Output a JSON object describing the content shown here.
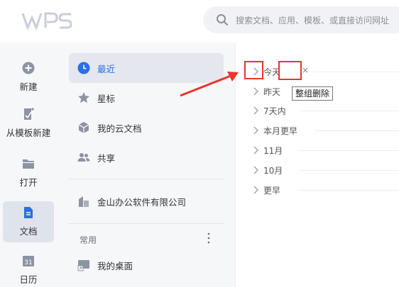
{
  "app": {
    "logo_text": "WPS",
    "accent": "#2b6ee8",
    "annotation_color": "#e8352f"
  },
  "search": {
    "placeholder": "搜索文档、应用、模板、或直接访问网址",
    "icon": "search-icon"
  },
  "rail": {
    "items": [
      {
        "label": "新建",
        "icon": "plus-circle-icon"
      },
      {
        "label": "从模板新建",
        "icon": "template-icon"
      },
      {
        "label": "打开",
        "icon": "folder-icon"
      },
      {
        "label": "文档",
        "icon": "document-icon",
        "active": true
      },
      {
        "label": "日历",
        "icon": "calendar-icon",
        "badge": "31"
      }
    ]
  },
  "nav": {
    "items": [
      {
        "label": "最近",
        "icon": "clock-icon",
        "active": true
      },
      {
        "label": "星标",
        "icon": "star-icon"
      },
      {
        "label": "我的云文档",
        "icon": "cloud-box-icon"
      },
      {
        "label": "共享",
        "icon": "users-icon"
      }
    ],
    "org": {
      "label": "金山办公软件有限公司",
      "icon": "building-icon"
    },
    "common": {
      "label": "常用",
      "more_icon": "more-vertical-icon"
    },
    "desktop": {
      "label": "我的桌面",
      "icon": "desktop-shortcut-icon"
    }
  },
  "groups": [
    {
      "label": "今天"
    },
    {
      "label": "昨天"
    },
    {
      "label": "7天内"
    },
    {
      "label": "本月更早"
    },
    {
      "label": "11月"
    },
    {
      "label": "10月"
    },
    {
      "label": "更早"
    }
  ],
  "close_symbol": "×",
  "tooltip": {
    "text": "整组删除"
  }
}
